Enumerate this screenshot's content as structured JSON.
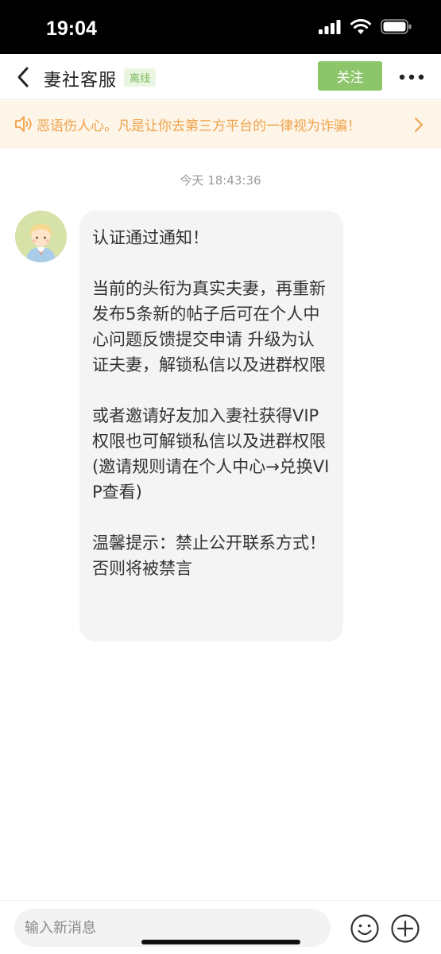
{
  "status_bar": {
    "time": "19:04",
    "icons": [
      "signal-icon",
      "wifi-icon",
      "battery-icon"
    ]
  },
  "header": {
    "title": "妻社客服",
    "status_badge": "离线",
    "follow_label": "关注",
    "back_icon": "chevron-left-icon",
    "more_icon": "more-dots-icon"
  },
  "notice": {
    "icon": "speaker-icon",
    "text": "恶语伤人心。凡是让你去第三方平台的一律视为诈骗！",
    "arrow_icon": "chevron-right-icon"
  },
  "chat": {
    "timestamp": "今天 18:43:36",
    "messages": [
      {
        "sender_avatar": "avatar-icon",
        "paragraphs": [
          "认证通过通知！",
          "当前的头衔为真实夫妻，再重新发布5条新的帖子后可在个人中心问题反馈提交申请 升级为认证夫妻，解锁私信以及进群权限",
          "或者邀请好友加入妻社获得VIP权限也可解锁私信以及进群权限(邀请规则请在个人中心→兑换VIP查看)",
          "温馨提示：禁止公开联系方式！否则将被禁言"
        ]
      }
    ]
  },
  "input_bar": {
    "placeholder": "输入新消息",
    "value": "",
    "emoji_icon": "emoji-icon",
    "plus_icon": "plus-circle-icon"
  },
  "colors": {
    "accent_green": "#8dc66a",
    "offline_badge_bg": "#e9f5e1",
    "offline_badge_text": "#7cba5a",
    "notice_bg": "#fdf5e8",
    "notice_text": "#f0a24a",
    "bubble_bg": "#f4f4f4"
  }
}
